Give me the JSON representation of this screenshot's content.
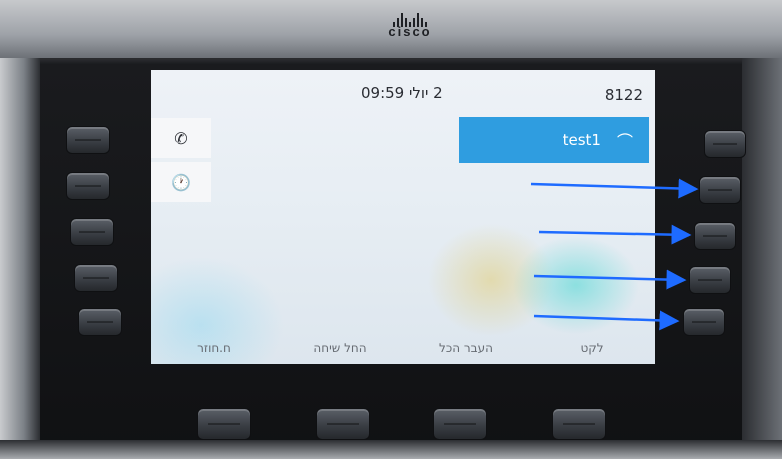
{
  "brand": "cisco",
  "screen": {
    "date_time": "2 יולי 09:59",
    "extension": "8122",
    "side_tabs": [
      {
        "icon": "phone-icon",
        "glyph": "✆"
      },
      {
        "icon": "recents-clock-icon",
        "glyph": "🕐"
      }
    ],
    "line": {
      "label": "test1",
      "icon": "hangup-icon",
      "glyph": "⌒"
    },
    "softkeys": [
      "ח.חוזר",
      "החל שיחה",
      "העבר הכל",
      "לקט"
    ]
  },
  "colors": {
    "line_highlight": "#2f9de0",
    "annotation_arrow": "#1e6bff"
  }
}
